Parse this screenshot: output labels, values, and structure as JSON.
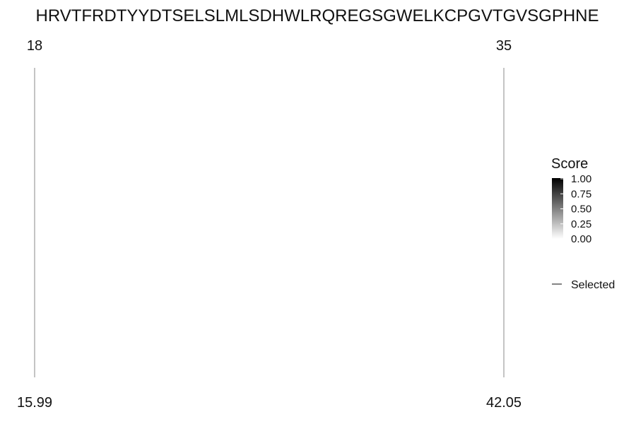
{
  "chart_data": {
    "type": "line",
    "title": "HRVTFRDTYYDTSELSLMLSDHWLRQREGSGWELKCPGVTGVSGPHNE",
    "series": [
      {
        "name": "Selected",
        "top_labels": [
          "18",
          "35"
        ],
        "bottom_labels": [
          "15.99",
          "42.05"
        ]
      }
    ],
    "legend": {
      "title": "Score",
      "ticks": [
        "1.00",
        "0.75",
        "0.50",
        "0.25",
        "0.00"
      ],
      "entry": "Selected",
      "placement": "right"
    },
    "colors": {
      "line": "#888888",
      "score_high": "#000000",
      "score_low": "#ffffff"
    }
  }
}
